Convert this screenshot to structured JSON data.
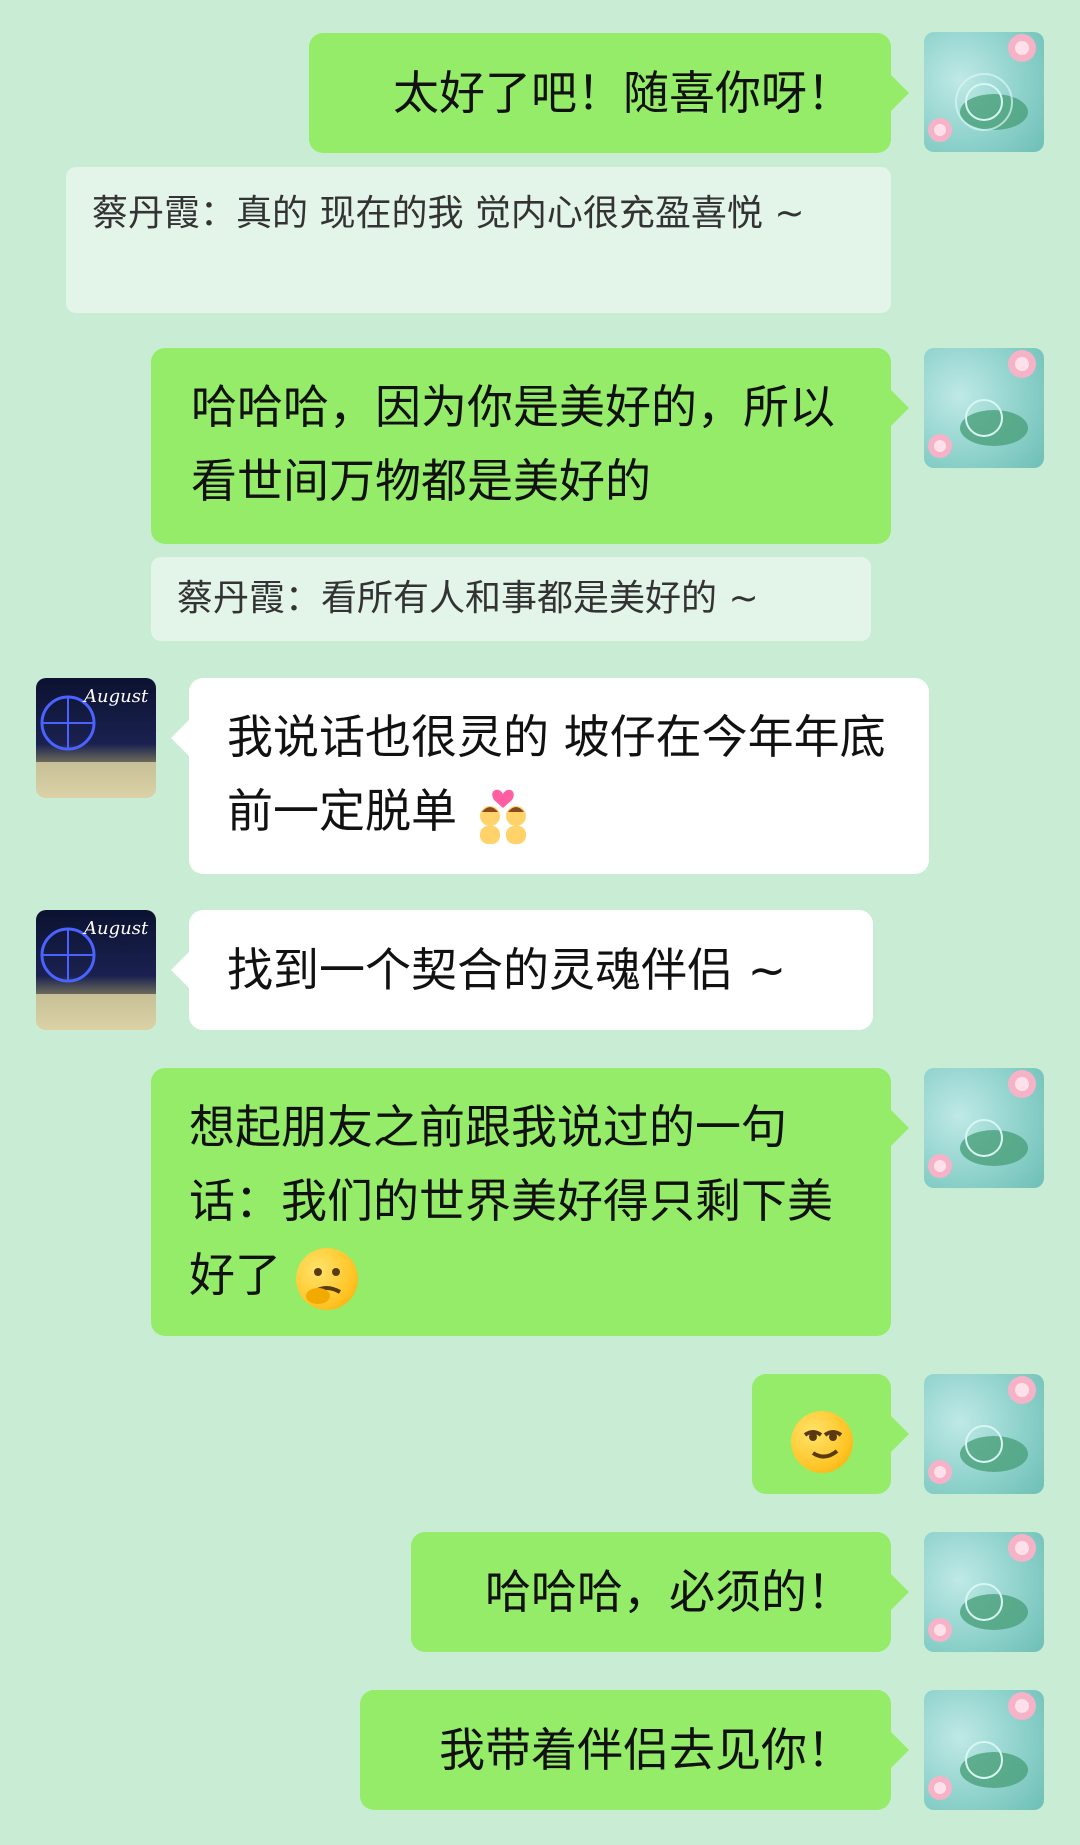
{
  "messages": [
    {
      "kind": "me",
      "text": "太好了吧！随喜你呀！"
    },
    {
      "kind": "quote",
      "text": "蔡丹霞：真的 现在的我 觉内心很充盈喜悦 ~"
    },
    {
      "kind": "me",
      "text": "哈哈哈，因为你是美好的，所以看世间万物都是美好的"
    },
    {
      "kind": "quote",
      "text": "蔡丹霞：看所有人和事都是美好的 ~"
    },
    {
      "kind": "other",
      "text": "我说话也很灵的 坡仔在今年年底前一定脱单"
    },
    {
      "kind": "other",
      "text": "找到一个契合的灵魂伴侣 ~"
    },
    {
      "kind": "me",
      "text": "想起朋友之前跟我说过的一句话：我们的世界美好得只剩下美好了"
    },
    {
      "kind": "me",
      "text": ""
    },
    {
      "kind": "me",
      "text": "哈哈哈，必须的！"
    },
    {
      "kind": "me",
      "text": "我带着伴侣去见你！"
    }
  ],
  "other_avatar_caption": "August",
  "icons": [
    "couple-emoji-icon",
    "thinking-emoji-icon",
    "smirk-emoji-icon"
  ],
  "colors": {
    "background": "#c9ecd4",
    "me_bubble": "#95ec69",
    "other_bubble": "#ffffff",
    "quote_bubble": "#e3f4e8"
  }
}
